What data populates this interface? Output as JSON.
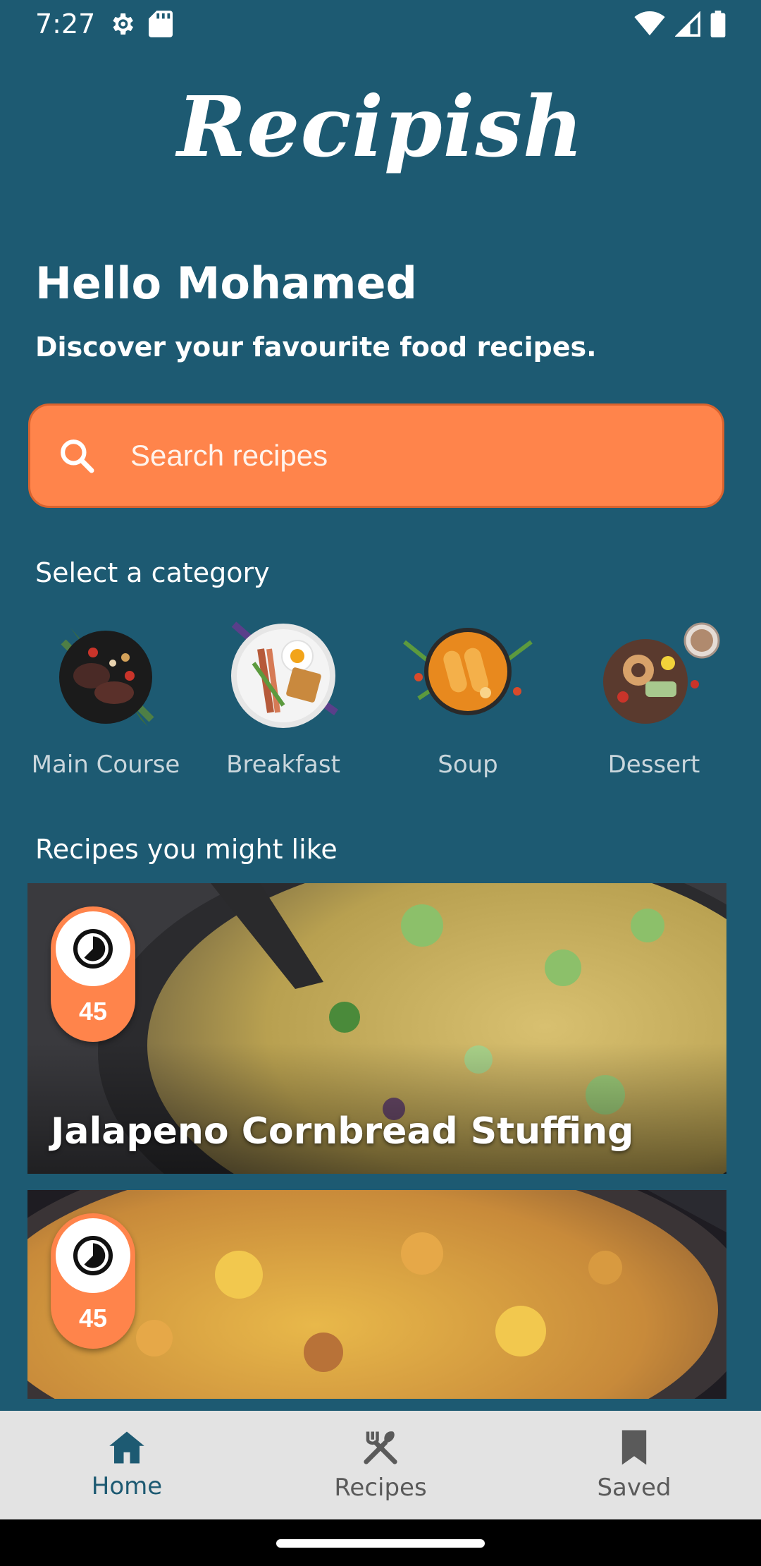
{
  "status_bar": {
    "time": "7:27",
    "icons": [
      "settings-icon",
      "sd-card-icon",
      "wifi-icon",
      "signal-icon",
      "battery-icon"
    ]
  },
  "app": {
    "logo": "Recipish",
    "greeting": "Hello Mohamed",
    "subtitle": "Discover your favourite food recipes."
  },
  "search": {
    "placeholder": "Search recipes",
    "icon": "search-icon"
  },
  "categories": {
    "title": "Select a category",
    "items": [
      {
        "label": "Main Course",
        "icon": "steak-plate"
      },
      {
        "label": "Breakfast",
        "icon": "breakfast-plate"
      },
      {
        "label": "Soup",
        "icon": "soup-bowl"
      },
      {
        "label": "Dessert",
        "icon": "dessert-plate"
      }
    ]
  },
  "recipes": {
    "title": "Recipes you might like",
    "items": [
      {
        "time": "45",
        "name": "Jalapeno Cornbread Stuffing"
      },
      {
        "time": "45",
        "name": ""
      }
    ]
  },
  "bottom_nav": {
    "items": [
      {
        "label": "Home",
        "icon": "home-icon",
        "active": true
      },
      {
        "label": "Recipes",
        "icon": "fork-knife-icon",
        "active": false
      },
      {
        "label": "Saved",
        "icon": "bookmark-icon",
        "active": false
      }
    ]
  },
  "colors": {
    "background": "#1D5A72",
    "accent": "#FF844B",
    "nav_background": "#E3E3E3",
    "nav_active": "#1D5A72"
  }
}
